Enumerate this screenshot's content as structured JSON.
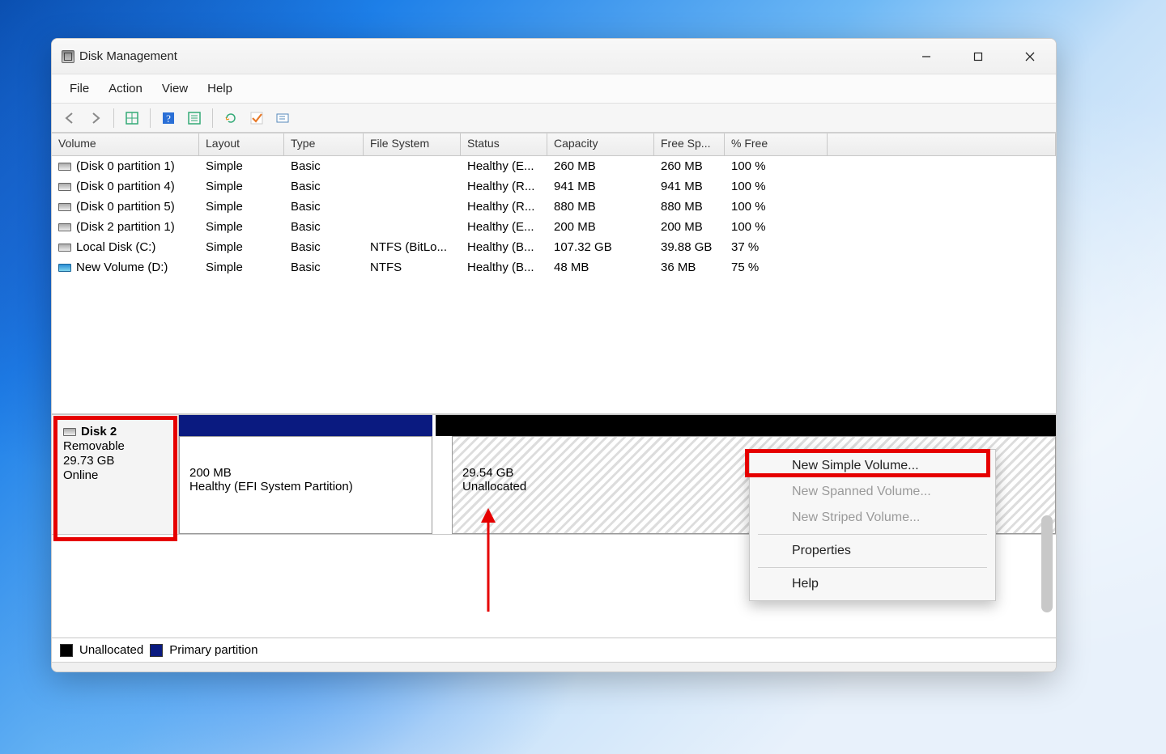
{
  "window": {
    "title": "Disk Management"
  },
  "menu": {
    "file": "File",
    "action": "Action",
    "view": "View",
    "help": "Help"
  },
  "headers": {
    "volume": "Volume",
    "layout": "Layout",
    "type": "Type",
    "fs": "File System",
    "status": "Status",
    "capacity": "Capacity",
    "free": "Free Sp...",
    "pct": "% Free"
  },
  "volumes": [
    {
      "vol": "(Disk 0 partition 1)",
      "layout": "Simple",
      "type": "Basic",
      "fs": "",
      "status": "Healthy (E...",
      "cap": "260 MB",
      "free": "260 MB",
      "pct": "100 %",
      "iconBlue": false
    },
    {
      "vol": "(Disk 0 partition 4)",
      "layout": "Simple",
      "type": "Basic",
      "fs": "",
      "status": "Healthy (R...",
      "cap": "941 MB",
      "free": "941 MB",
      "pct": "100 %",
      "iconBlue": false
    },
    {
      "vol": "(Disk 0 partition 5)",
      "layout": "Simple",
      "type": "Basic",
      "fs": "",
      "status": "Healthy (R...",
      "cap": "880 MB",
      "free": "880 MB",
      "pct": "100 %",
      "iconBlue": false
    },
    {
      "vol": "(Disk 2 partition 1)",
      "layout": "Simple",
      "type": "Basic",
      "fs": "",
      "status": "Healthy (E...",
      "cap": "200 MB",
      "free": "200 MB",
      "pct": "100 %",
      "iconBlue": false
    },
    {
      "vol": "Local Disk (C:)",
      "layout": "Simple",
      "type": "Basic",
      "fs": "NTFS (BitLo...",
      "status": "Healthy (B...",
      "cap": "107.32 GB",
      "free": "39.88 GB",
      "pct": "37 %",
      "iconBlue": false
    },
    {
      "vol": "New Volume (D:)",
      "layout": "Simple",
      "type": "Basic",
      "fs": "NTFS",
      "status": "Healthy (B...",
      "cap": "48 MB",
      "free": "36 MB",
      "pct": "75 %",
      "iconBlue": true
    }
  ],
  "disk": {
    "name": "Disk 2",
    "kind": "Removable",
    "size": "29.73 GB",
    "state": "Online",
    "partitions": {
      "p1_size": "200 MB",
      "p1_desc": "Healthy (EFI System Partition)",
      "p2_size": "29.54 GB",
      "p2_desc": "Unallocated"
    }
  },
  "legend": {
    "unallocated": "Unallocated",
    "primary": "Primary partition"
  },
  "contextMenu": {
    "newSimple": "New Simple Volume...",
    "newSpanned": "New Spanned Volume...",
    "newStriped": "New Striped Volume...",
    "properties": "Properties",
    "help": "Help"
  }
}
